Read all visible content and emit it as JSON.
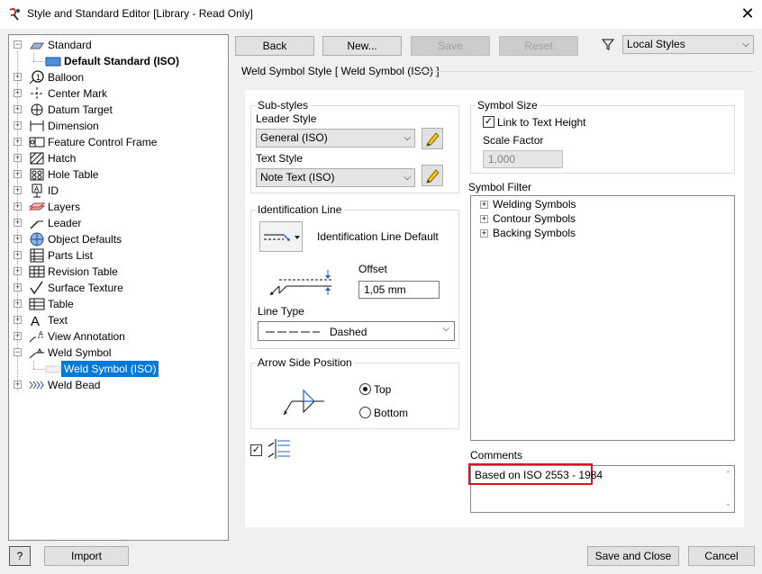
{
  "window": {
    "title": "Style and Standard Editor [Library - Read Only]"
  },
  "tree": {
    "items": [
      {
        "label": "Standard",
        "exp": "−",
        "icon": "standard-icon",
        "bold": false
      },
      {
        "label": "Default Standard (ISO)",
        "exp": "",
        "icon": "default-standard-icon",
        "bold": true
      },
      {
        "label": "Balloon",
        "exp": "+",
        "icon": "balloon-icon"
      },
      {
        "label": "Center Mark",
        "exp": "+",
        "icon": "center-mark-icon"
      },
      {
        "label": "Datum Target",
        "exp": "+",
        "icon": "datum-target-icon"
      },
      {
        "label": "Dimension",
        "exp": "+",
        "icon": "dimension-icon"
      },
      {
        "label": "Feature Control Frame",
        "exp": "+",
        "icon": "feature-control-frame-icon"
      },
      {
        "label": "Hatch",
        "exp": "+",
        "icon": "hatch-icon"
      },
      {
        "label": "Hole Table",
        "exp": "+",
        "icon": "hole-table-icon"
      },
      {
        "label": "ID",
        "exp": "+",
        "icon": "id-icon"
      },
      {
        "label": "Layers",
        "exp": "+",
        "icon": "layers-icon"
      },
      {
        "label": "Leader",
        "exp": "+",
        "icon": "leader-icon"
      },
      {
        "label": "Object Defaults",
        "exp": "+",
        "icon": "object-defaults-icon"
      },
      {
        "label": "Parts List",
        "exp": "+",
        "icon": "parts-list-icon"
      },
      {
        "label": "Revision Table",
        "exp": "+",
        "icon": "revision-table-icon"
      },
      {
        "label": "Surface Texture",
        "exp": "+",
        "icon": "surface-texture-icon"
      },
      {
        "label": "Table",
        "exp": "+",
        "icon": "table-icon"
      },
      {
        "label": "Text",
        "exp": "+",
        "icon": "text-icon"
      },
      {
        "label": "View Annotation",
        "exp": "+",
        "icon": "view-annotation-icon"
      },
      {
        "label": "Weld Symbol",
        "exp": "−",
        "icon": "weld-symbol-icon"
      },
      {
        "label": "Weld Symbol (ISO)",
        "exp": "",
        "icon": "weld-symbol-style-icon",
        "selected": true
      },
      {
        "label": "Weld Bead",
        "exp": "+",
        "icon": "weld-bead-icon"
      }
    ]
  },
  "toolbar": {
    "back": "Back",
    "new": "New...",
    "save": "Save",
    "reset": "Reset",
    "filter_icon": "filter-icon",
    "styles_filter": "Local Styles"
  },
  "panel": {
    "title": "Weld Symbol Style [ Weld Symbol (ISO) ]",
    "substyles": {
      "legend": "Sub-styles",
      "leader_style_label": "Leader Style",
      "leader_style_value": "General (ISO)",
      "text_style_label": "Text Style",
      "text_style_value": "Note Text (ISO)"
    },
    "identification": {
      "legend": "Identification Line",
      "default_label": "Identification Line Default",
      "offset_label": "Offset",
      "offset_value": "1,05 mm",
      "line_type_label": "Line Type",
      "line_type_value": "Dashed"
    },
    "arrow_side": {
      "legend": "Arrow Side Position",
      "top": "Top",
      "bottom": "Bottom",
      "selected": "Top"
    },
    "symbol_size": {
      "legend": "Symbol Size",
      "link_label": "Link to Text Height",
      "link_checked": true,
      "scale_label": "Scale Factor",
      "scale_value": "1,000"
    },
    "symbol_filter": {
      "label": "Symbol Filter",
      "items": [
        "Welding Symbols",
        "Contour Symbols",
        "Backing Symbols"
      ]
    },
    "comments": {
      "label": "Comments",
      "value": "Based on ISO 2553 - 1984",
      "highlight_color": "#d9141e"
    }
  },
  "footer": {
    "help": "?",
    "import": "Import",
    "save_close": "Save and Close",
    "cancel": "Cancel"
  },
  "colors": {
    "selection": "#0078d7",
    "accent_blue": "#1e64c8"
  }
}
